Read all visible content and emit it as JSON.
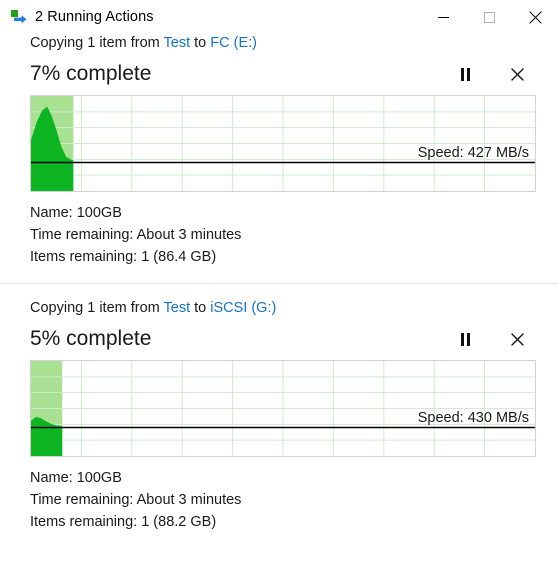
{
  "window": {
    "title": "2 Running Actions",
    "icon": "copy-arrow-icon",
    "minimize_label": "—",
    "maximize_label": "□",
    "close_label": "✕",
    "maximize_disabled": true
  },
  "theme": {
    "link_color": "#1673c8",
    "progress_light": "#a7e191",
    "progress_dark": "#0db522",
    "grid_color": "#cdeccd",
    "border_color": "#d2d2d2",
    "text_color": "#1a1a1a",
    "icon_green": "#22a11f",
    "icon_blue": "#2a7fd4"
  },
  "transfers": [
    {
      "copy_prefix": "Copying 1 item from ",
      "source": "Test",
      "copy_middle": " to ",
      "destination": "FC (E:)",
      "percent_text": "7% complete",
      "percent_value": 7,
      "pause_label": "Pause",
      "cancel_label": "Cancel",
      "speed_label": "Speed: 427 MB/s",
      "speed_value": 427,
      "speed_unit": "MB/s",
      "name_label": "Name:  100GB",
      "time_label": "Time remaining:  About 3 minutes",
      "items_label": "Items remaining:  1 (86.4 GB)"
    },
    {
      "copy_prefix": "Copying 1 item from ",
      "source": "Test",
      "copy_middle": " to ",
      "destination": "iSCSI (G:)",
      "percent_text": "5% complete",
      "percent_value": 5,
      "pause_label": "Pause",
      "cancel_label": "Cancel",
      "speed_label": "Speed: 430 MB/s",
      "speed_value": 430,
      "speed_unit": "MB/s",
      "name_label": "Name:  100GB",
      "time_label": "Time remaining:  About 3 minutes",
      "items_label": "Items remaining:  1 (88.2 GB)"
    }
  ],
  "chart_data": [
    {
      "type": "area",
      "title": "Transfer speed 1",
      "baseline_ratio": 0.7,
      "progress_percent": 8.4,
      "grid_cols": 10,
      "grid_rows": 6,
      "points": [
        {
          "x": 0.0,
          "y": 0.34
        },
        {
          "x": 0.012,
          "y": 0.62
        },
        {
          "x": 0.022,
          "y": 0.78
        },
        {
          "x": 0.032,
          "y": 0.84
        },
        {
          "x": 0.04,
          "y": 0.72
        },
        {
          "x": 0.05,
          "y": 0.5
        },
        {
          "x": 0.06,
          "y": 0.24
        },
        {
          "x": 0.07,
          "y": 0.08
        },
        {
          "x": 0.084,
          "y": 0.03
        }
      ]
    },
    {
      "type": "area",
      "title": "Transfer speed 2",
      "baseline_ratio": 0.7,
      "progress_percent": 6.2,
      "grid_cols": 10,
      "grid_rows": 6,
      "points": [
        {
          "x": 0.0,
          "y": 0.1
        },
        {
          "x": 0.01,
          "y": 0.16
        },
        {
          "x": 0.02,
          "y": 0.14
        },
        {
          "x": 0.028,
          "y": 0.1
        },
        {
          "x": 0.038,
          "y": 0.06
        },
        {
          "x": 0.05,
          "y": 0.03
        },
        {
          "x": 0.062,
          "y": 0.02
        }
      ]
    }
  ]
}
